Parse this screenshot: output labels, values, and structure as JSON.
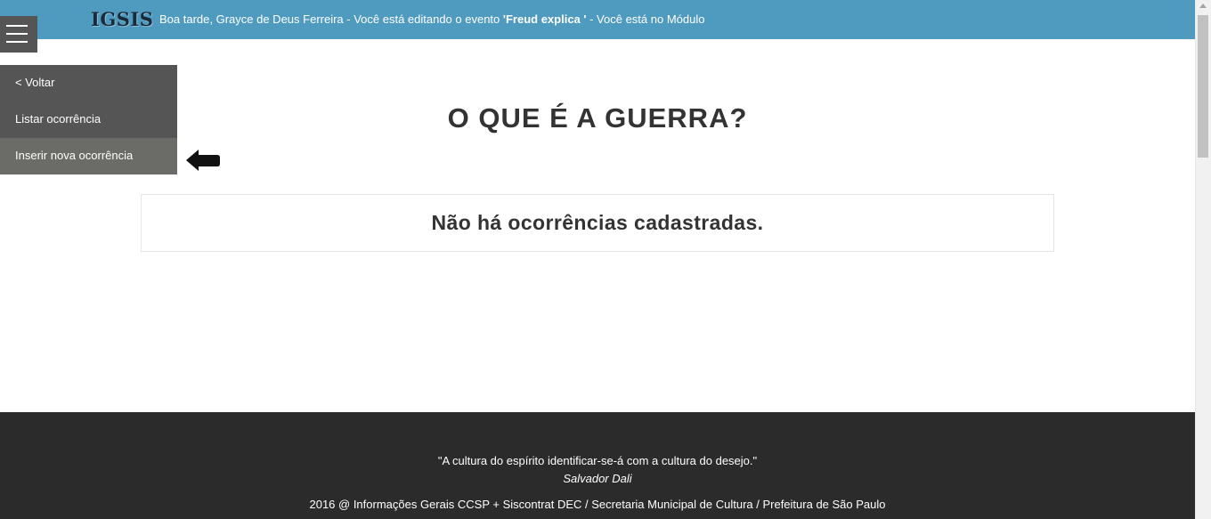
{
  "header": {
    "logo": "IGSIS",
    "greeting_prefix": "Boa tarde, Grayce de Deus Ferreira - Você está editando o evento ",
    "event_name": "'Freud explica '",
    "greeting_suffix": " - Você está no Módulo"
  },
  "menu": {
    "toggle_icon": "hamburger-icon",
    "items": [
      {
        "label": "< Voltar"
      },
      {
        "label": "Listar ocorrência"
      },
      {
        "label": "Inserir nova ocorrência"
      }
    ]
  },
  "annotation": {
    "icon": "left-arrow-icon"
  },
  "main": {
    "title": "O QUE É A GUERRA?",
    "notice": "Não há ocorrências cadastradas."
  },
  "footer": {
    "quote": "\"A cultura do espírito identificar-se-á com a cultura do desejo.\"",
    "author": "Salvador Dali",
    "credits": "2016 @ Informações Gerais CCSP + Siscontrat DEC / Secretaria Municipal de Cultura / Prefeitura de São Paulo"
  },
  "colors": {
    "topbar": "#4f9bc0",
    "menu_bg": "#555555",
    "menu_active": "#6b6b67",
    "footer_bg": "#2b2b2b",
    "text_dark": "#333333"
  }
}
